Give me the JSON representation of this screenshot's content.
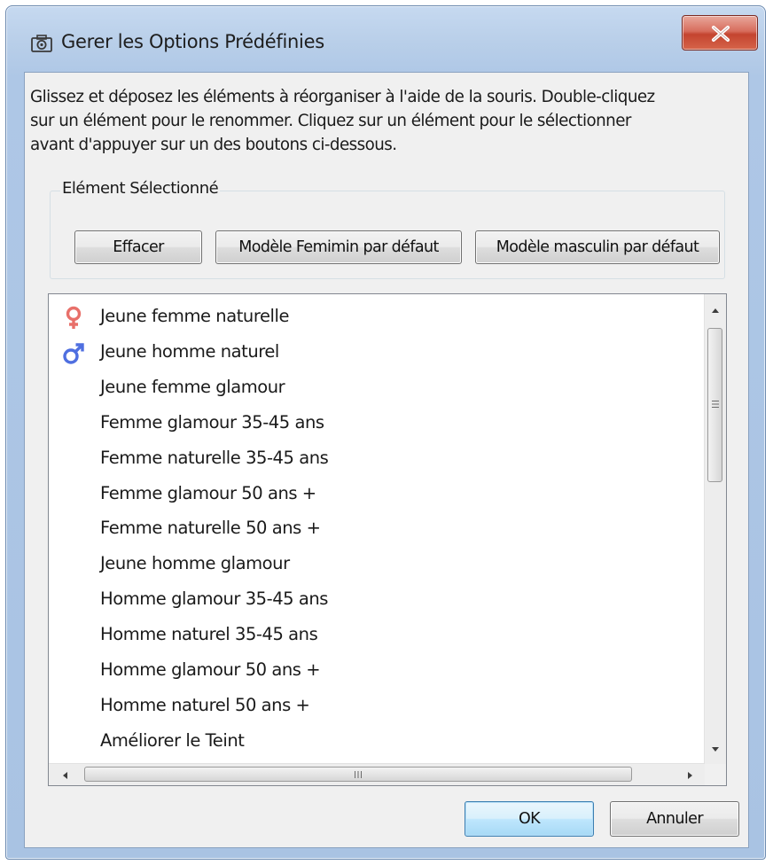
{
  "window": {
    "title": "Gerer les Options Prédéfinies",
    "icon": "camera-icon",
    "close_icon": "close-x-icon"
  },
  "instructions": "Glissez et déposez les éléments à réorganiser à l'aide de la souris. Double-cliquez\nsur un élément pour le renommer.  Cliquez sur un élément pour le sélectionner\navant d'appuyer sur un des boutons ci-dessous.",
  "selected_group": {
    "label": "Elément Sélectionné",
    "buttons": {
      "clear": "Effacer",
      "female_default": "Modèle Femimin par défaut",
      "male_default": "Modèle masculin par défaut"
    }
  },
  "presets": [
    {
      "label": "Jeune femme naturelle",
      "icon": "female-symbol-icon"
    },
    {
      "label": "Jeune homme naturel",
      "icon": "male-symbol-icon"
    },
    {
      "label": "Jeune femme glamour",
      "icon": ""
    },
    {
      "label": "Femme glamour 35-45 ans",
      "icon": ""
    },
    {
      "label": "Femme naturelle 35-45 ans",
      "icon": ""
    },
    {
      "label": "Femme glamour 50 ans +",
      "icon": ""
    },
    {
      "label": "Femme naturelle 50 ans +",
      "icon": ""
    },
    {
      "label": "Jeune homme glamour",
      "icon": ""
    },
    {
      "label": "Homme glamour 35-45 ans",
      "icon": ""
    },
    {
      "label": "Homme naturel 35-45 ans",
      "icon": ""
    },
    {
      "label": "Homme glamour 50 ans +",
      "icon": ""
    },
    {
      "label": "Homme naturel 50 ans +",
      "icon": ""
    },
    {
      "label": "Améliorer le Teint",
      "icon": ""
    }
  ],
  "footer": {
    "ok": "OK",
    "cancel": "Annuler"
  },
  "colors": {
    "female": "#e8706a",
    "male": "#4f6fe0",
    "ok_border": "#3c7fb1"
  }
}
